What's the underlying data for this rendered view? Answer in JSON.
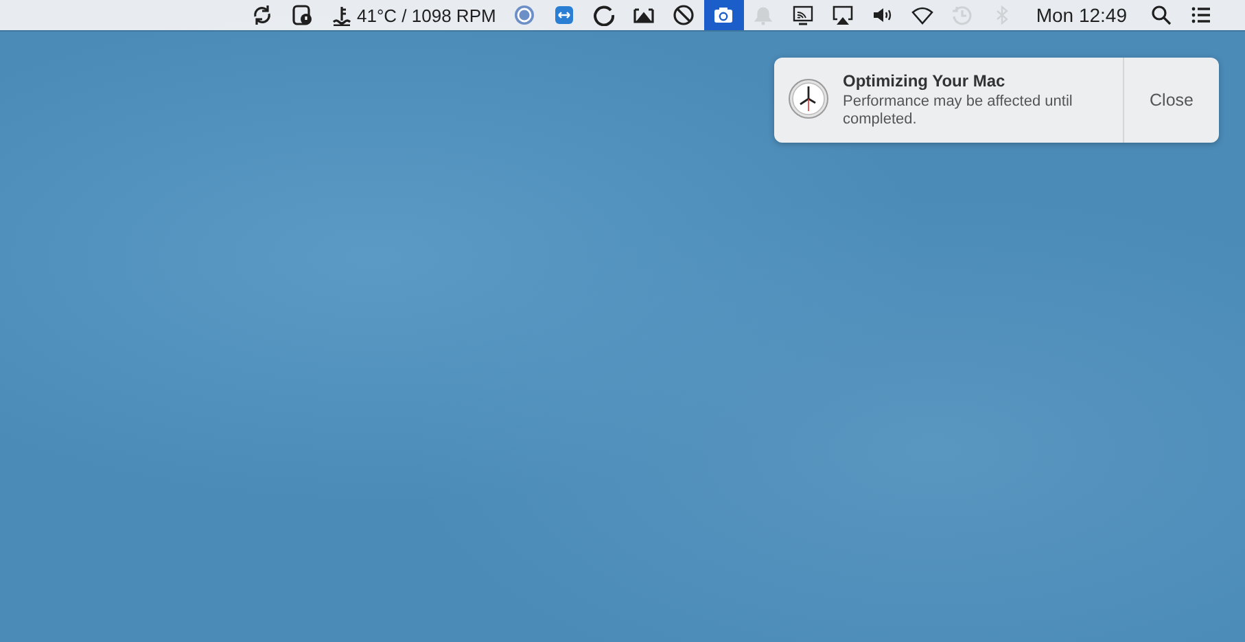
{
  "menu_bar": {
    "status_items": [
      {
        "kind": "sync",
        "highlighted": false,
        "dimmed": false
      },
      {
        "kind": "alert-phone",
        "highlighted": false,
        "dimmed": false
      },
      {
        "kind": "temperature",
        "text": "41°C / 1098 RPM",
        "highlighted": false,
        "dimmed": false
      },
      {
        "kind": "te-logo",
        "highlighted": false,
        "dimmed": false
      },
      {
        "kind": "remote",
        "highlighted": false,
        "dimmed": false
      },
      {
        "kind": "ring",
        "highlighted": false,
        "dimmed": false
      },
      {
        "kind": "tray",
        "highlighted": false,
        "dimmed": false
      },
      {
        "kind": "no-entry",
        "highlighted": false,
        "dimmed": false
      },
      {
        "kind": "camera",
        "highlighted": true,
        "dimmed": false
      },
      {
        "kind": "bell",
        "highlighted": false,
        "dimmed": true
      },
      {
        "kind": "cast",
        "highlighted": false,
        "dimmed": false
      },
      {
        "kind": "airplay",
        "highlighted": false,
        "dimmed": false
      },
      {
        "kind": "volume",
        "highlighted": false,
        "dimmed": false
      },
      {
        "kind": "wifi",
        "highlighted": false,
        "dimmed": false
      },
      {
        "kind": "time-machine",
        "highlighted": false,
        "dimmed": true
      },
      {
        "kind": "bluetooth",
        "highlighted": false,
        "dimmed": true
      },
      {
        "kind": "clock",
        "text": "Mon 12:49",
        "highlighted": false,
        "dimmed": false
      },
      {
        "kind": "search",
        "highlighted": false,
        "dimmed": false
      },
      {
        "kind": "list",
        "highlighted": false,
        "dimmed": false
      }
    ]
  },
  "notification": {
    "title": "Optimizing Your Mac",
    "message": "Performance may be affected until completed.",
    "button": "Close"
  }
}
